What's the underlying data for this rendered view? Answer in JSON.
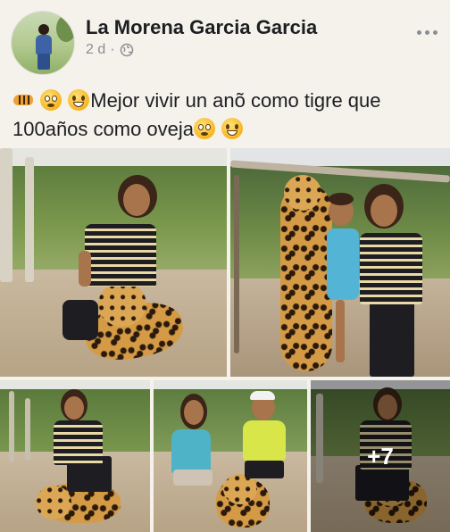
{
  "post": {
    "author": "La Morena Garcia Garcia",
    "time": "2 d",
    "separator": "·",
    "audience_icon": "globe-icon",
    "menu_icon": "more-options-icon",
    "caption_line1": "Mejor vivir un anõ como tigre  que",
    "caption_line2": "100años como oveja",
    "emojis": [
      "tiger-emoji",
      "flushed-face-emoji",
      "grinning-face-emoji"
    ]
  },
  "photos": {
    "count_visible": 5,
    "more_label": "+7"
  },
  "colors": {
    "background": "#f5f2ec",
    "author_text": "#1c1e21",
    "meta_text": "#8a8d91"
  }
}
